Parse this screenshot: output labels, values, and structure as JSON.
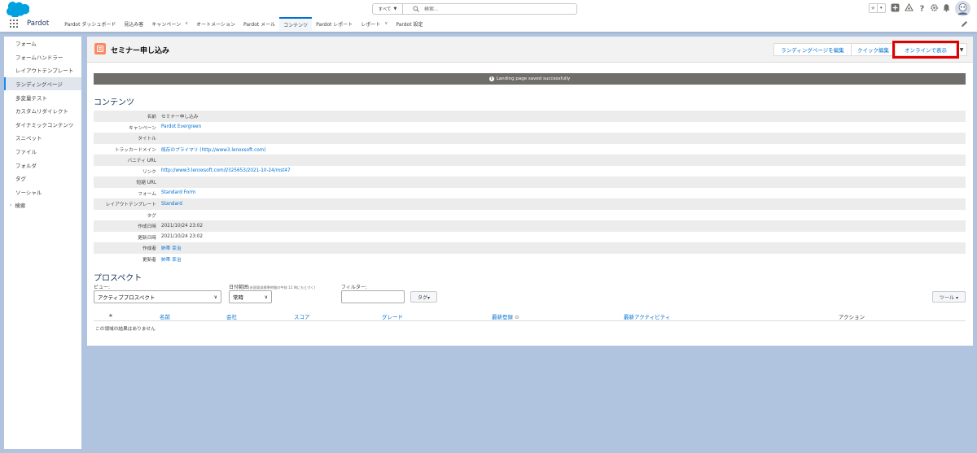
{
  "header": {
    "search_scope": "すべて",
    "search_placeholder": "検索..."
  },
  "nav": {
    "app_name": "Pardot",
    "items": [
      {
        "label": "Pardot ダッシュボード",
        "dropdown": false,
        "active": false
      },
      {
        "label": "見込み客",
        "dropdown": false,
        "active": false
      },
      {
        "label": "キャンペーン",
        "dropdown": true,
        "active": false
      },
      {
        "label": "オートメーション",
        "dropdown": false,
        "active": false
      },
      {
        "label": "Pardot メール",
        "dropdown": false,
        "active": false
      },
      {
        "label": "コンテンツ",
        "dropdown": false,
        "active": true
      },
      {
        "label": "Pardot レポート",
        "dropdown": false,
        "active": false
      },
      {
        "label": "レポート",
        "dropdown": true,
        "active": false
      },
      {
        "label": "Pardot 設定",
        "dropdown": false,
        "active": false
      }
    ]
  },
  "sidebar": {
    "items": [
      "フォーム",
      "フォームハンドラー",
      "レイアウトテンプレート",
      "ランディングページ",
      "多変量テスト",
      "カスタムリダイレクト",
      "ダイナミックコンテンツ",
      "スニペット",
      "ファイル",
      "フォルダ",
      "タグ",
      "ソーシャル",
      "検索"
    ],
    "active_index": 3
  },
  "page": {
    "title": "セミナー申し込み",
    "buttons": {
      "edit": "ランディングページを編集",
      "quick_edit": "クイック編集",
      "view_online": "オンラインで表示"
    },
    "toast": "Landing page saved successfully",
    "content_title": "コンテンツ",
    "details": [
      {
        "label": "名前",
        "value": "セミナー申し込み",
        "link": false
      },
      {
        "label": "キャンペーン",
        "value": "Pardot Evergreen",
        "link": true
      },
      {
        "label": "タイトル",
        "value": "",
        "link": false
      },
      {
        "label": "トラッカードメイン",
        "value": "既存のプライマリ (http://www3.lenoxsoft.com)",
        "link": true
      },
      {
        "label": "バニティ URL",
        "value": "",
        "link": false
      },
      {
        "label": "リンク",
        "value": "http://www3.lenoxsoft.com/l/325653/2021-10-24/mst47",
        "link": true
      },
      {
        "label": "短縮 URL",
        "value": "",
        "link": false
      },
      {
        "label": "フォーム",
        "value": "Standard Form",
        "link": true
      },
      {
        "label": "レイアウトテンプレート",
        "value": "Standard",
        "link": true
      },
      {
        "label": "タグ",
        "value": "",
        "link": false
      },
      {
        "label": "作成日時",
        "value": "2021/10/24 23:02",
        "link": false
      },
      {
        "label": "更新日時",
        "value": "2021/10/24 23:02",
        "link": false
      },
      {
        "label": "作成者",
        "value": "姉帯 幸治",
        "link": true
      },
      {
        "label": "更新者",
        "value": "姉帯 幸治",
        "link": true
      }
    ],
    "prospects_title": "プロスペクト",
    "filters": {
      "view_label": "ビュー:",
      "view_value": "アクティブプロスペクト",
      "date_label": "日付範囲",
      "date_note": "(米国東部標準時間の午前 12 時にもとづく)",
      "date_value": "常時",
      "filter_label": "フィルター:",
      "tag_button": "タグ▾",
      "tools_button": "ツール ▾"
    },
    "table_headers": [
      "名前",
      "会社",
      "スコア",
      "グレード",
      "最新登録",
      "最新アクティビティ",
      "アクション"
    ],
    "empty_text": "この領域の結果はありません"
  }
}
